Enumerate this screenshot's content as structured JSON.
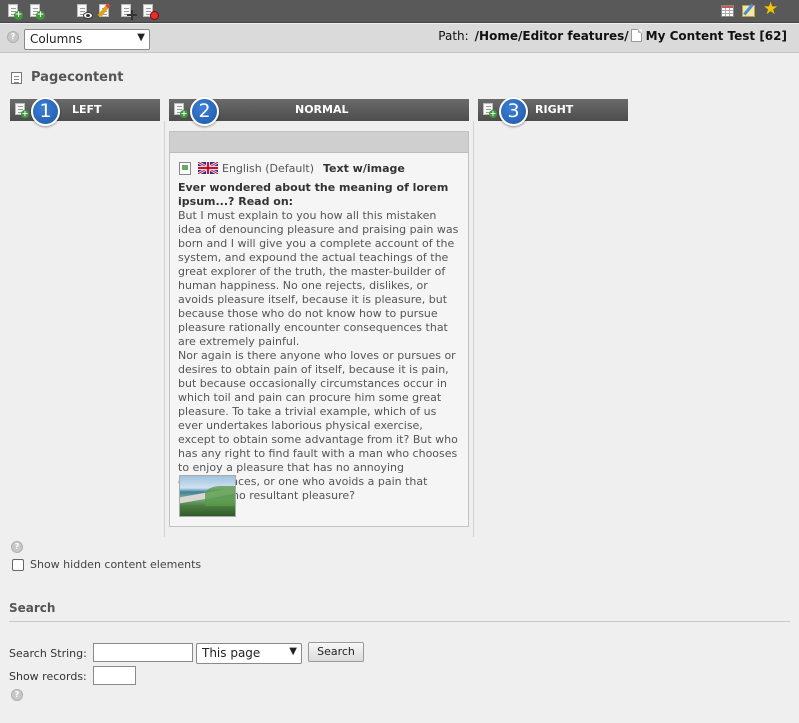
{
  "toolbar": {
    "left_icons": [
      "new-record-icon",
      "new-page-icon",
      "view-page-icon",
      "edit-page-icon",
      "move-page-icon",
      "page-history-icon"
    ],
    "right_icons": [
      "list-view-icon",
      "clipboard-icon",
      "bookmark-star-icon"
    ]
  },
  "view_selector": {
    "value": "Columns"
  },
  "path": {
    "label": "Path:",
    "location": "/Home/Editor features/",
    "page_title": "My Content Test [62]"
  },
  "section": {
    "title": "Pagecontent"
  },
  "columns": [
    {
      "number": "1",
      "label": "LEFT"
    },
    {
      "number": "2",
      "label": "NORMAL"
    },
    {
      "number": "3",
      "label": "RIGHT"
    }
  ],
  "content_element": {
    "language": "English (Default)",
    "type": "Text w/image",
    "headline": "Ever wondered about the meaning of lorem ipsum...? Read on:",
    "paragraph_1": "But I must explain to you how all this mistaken idea of denouncing pleasure and praising pain was born and I will give you a complete account of the system, and expound the actual teachings of the great explorer of the truth, the master-builder of human happiness. No one rejects, dislikes, or avoids pleasure itself, because it is pleasure, but because those who do not know how to pursue pleasure rationally encounter consequences that are extremely painful.",
    "paragraph_2": "Nor again is there anyone who loves or pursues or desires to obtain pain of itself, because it is pain, but because occasionally circumstances occur in which toil and pain can procure him some great pleasure. To take a trivial example, which of us ever undertakes laborious physical exercise, except to obtain some advantage from it? But who has any right to find fault with a man who chooses to enjoy a pleasure that has no annoying consequences, or one who avoids a pain that produces no resultant pleasure?"
  },
  "hidden_toggle": {
    "label": "Show hidden content elements",
    "checked": false
  },
  "search": {
    "title": "Search",
    "string_label": "Search String:",
    "string_value": "",
    "scope": "This page",
    "button_label": "Search",
    "records_label": "Show records:",
    "records_value": ""
  }
}
